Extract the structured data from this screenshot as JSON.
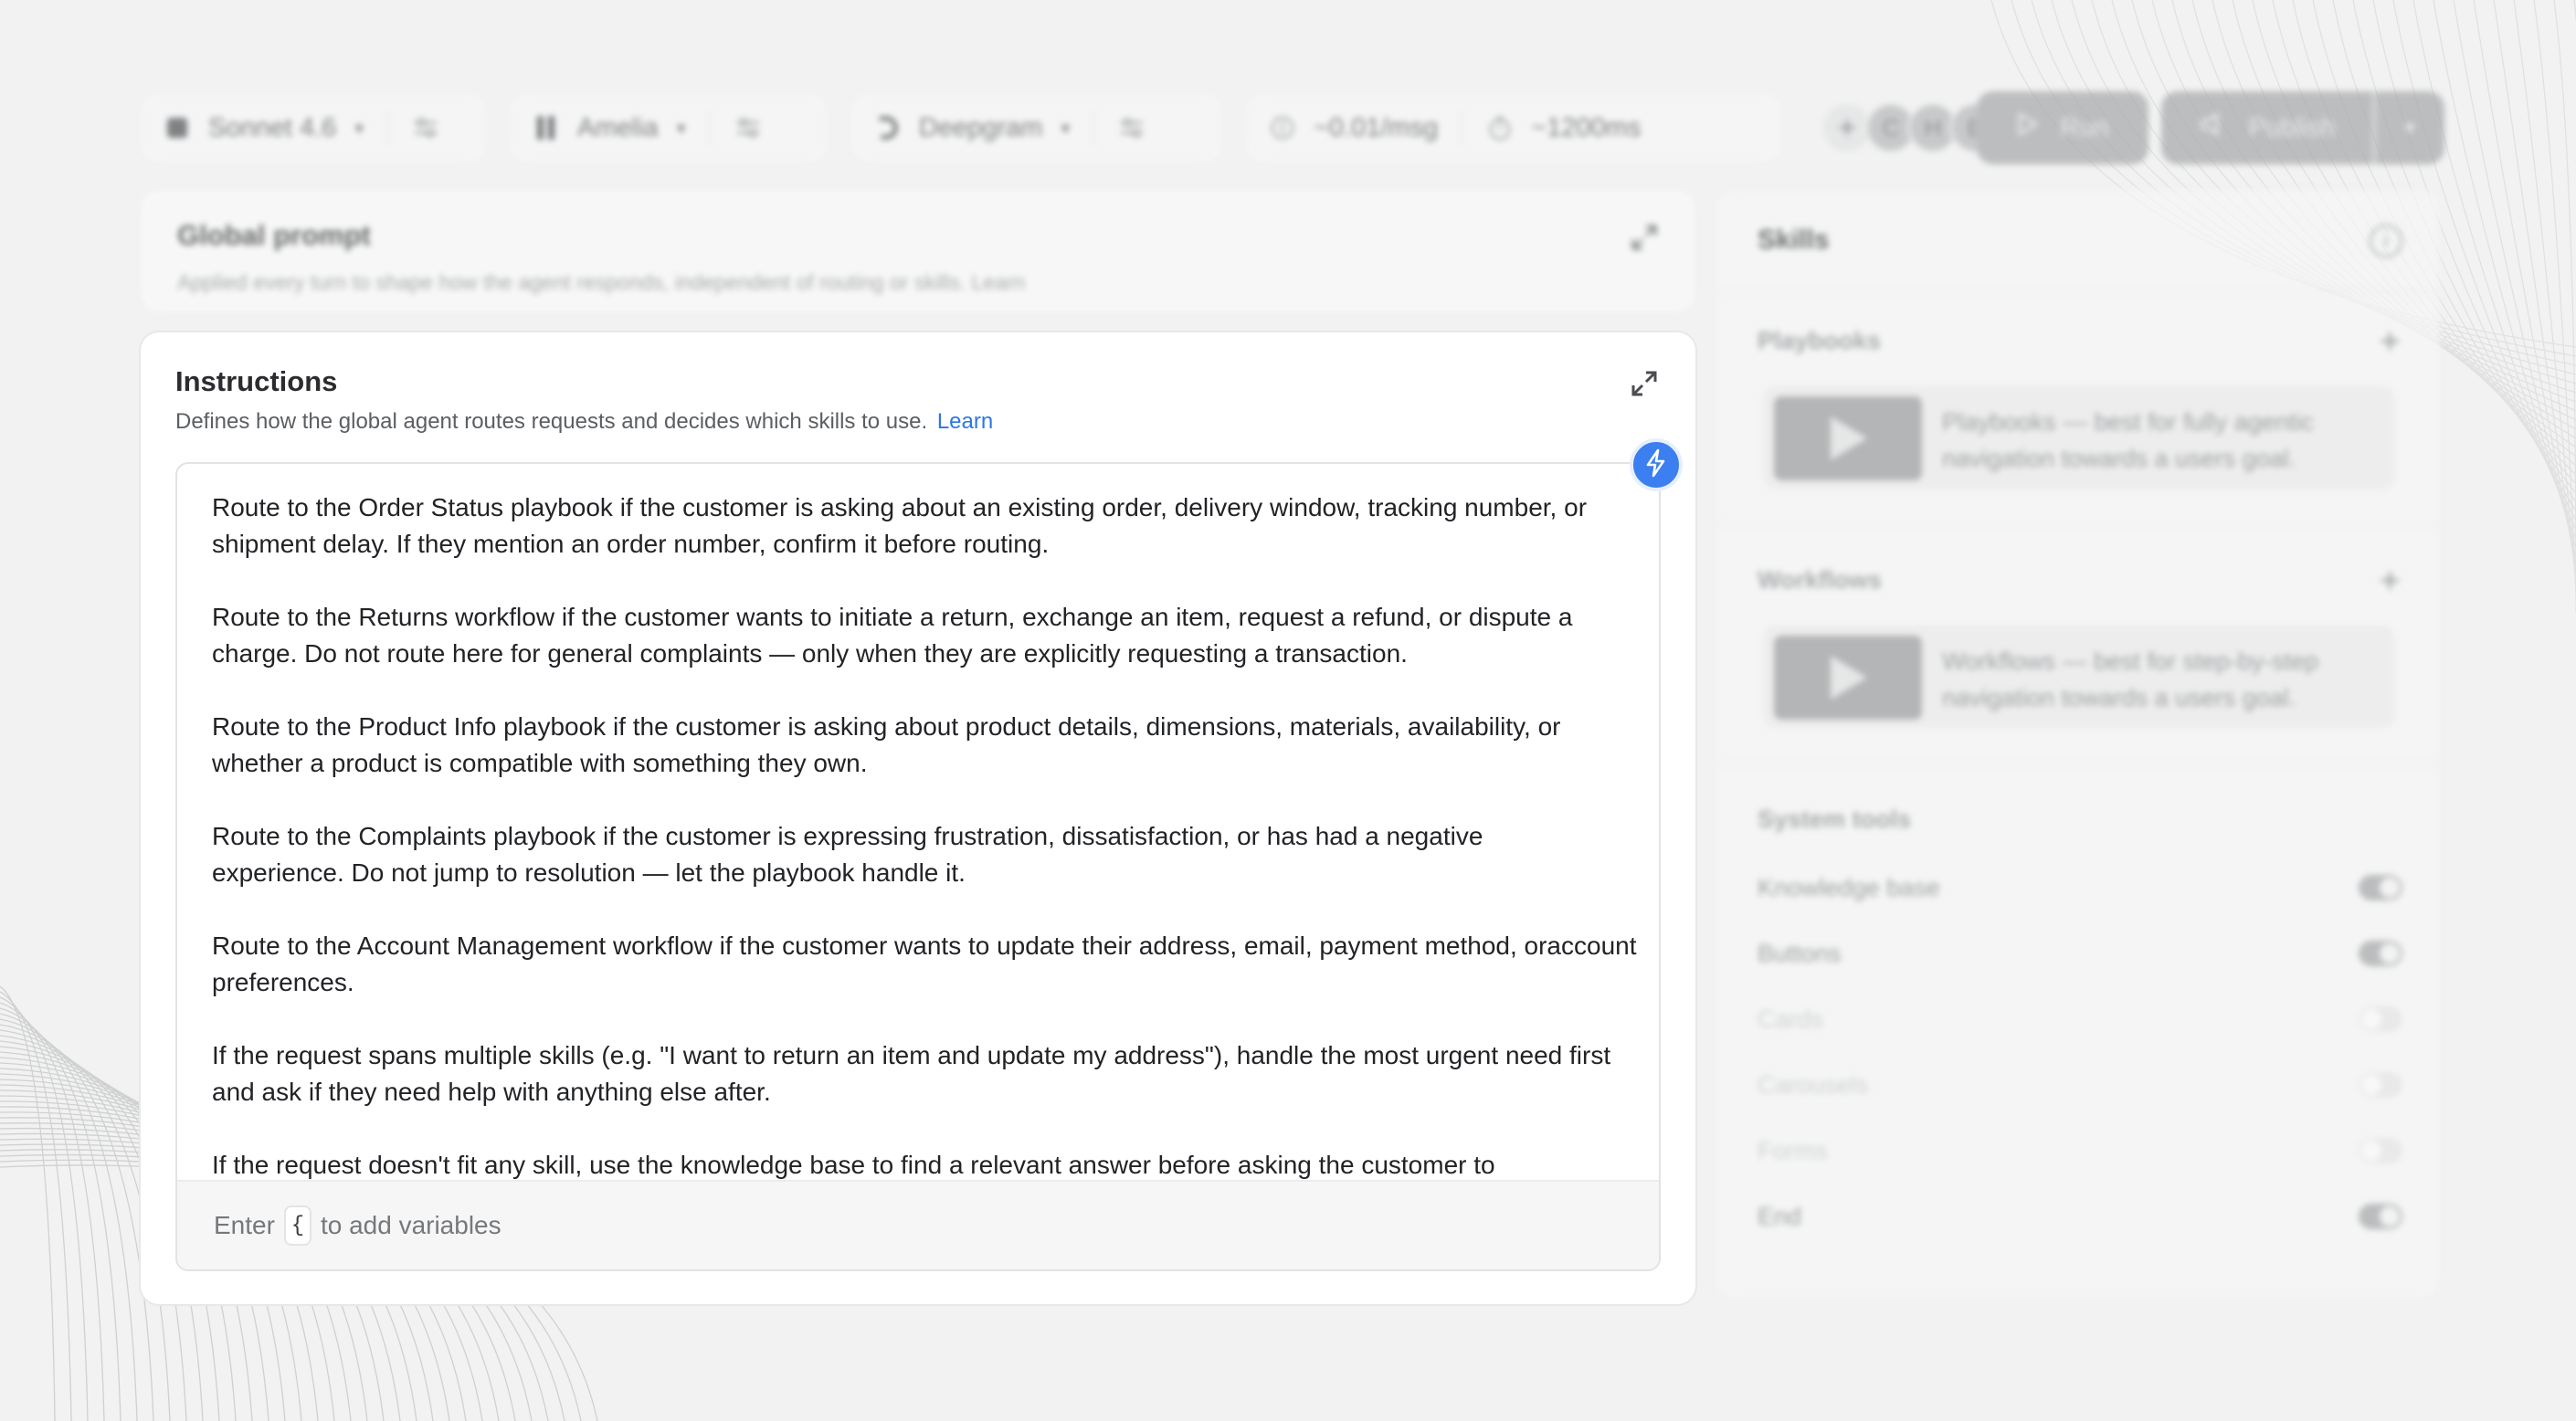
{
  "toolbar": {
    "model": {
      "label": "Sonnet 4.6",
      "icon": "model-icon"
    },
    "voice": {
      "label": "Amelia",
      "icon": "voice-bars-icon"
    },
    "transcriber": {
      "label": "Deepgram",
      "icon": "deepgram-icon"
    },
    "cost": "~0.01/msg",
    "latency": "~1200ms",
    "collaborators": [
      "C",
      "H",
      "E"
    ],
    "run_label": "Run",
    "publish_label": "Publish"
  },
  "global_prompt": {
    "title": "Global prompt",
    "description": "Applied every turn to shape how the agent responds, independent of routing or skills. Learn"
  },
  "instructions": {
    "title": "Instructions",
    "description": "Defines how the global agent routes requests and decides which skills to use.",
    "learn_label": "Learn",
    "paragraphs": [
      "Route to the Order Status playbook if the customer is asking about an existing order, delivery window, tracking number, or shipment delay. If they mention an order number, confirm it before routing.",
      "Route to the Returns workflow if the customer wants to initiate a return, exchange an item, request a refund, or dispute a charge. Do not route here for general complaints — only when they are explicitly requesting a transaction.",
      "Route to the Product Info playbook if the customer is asking about product details, dimensions, materials, availability, or whether a product is compatible with something they own.",
      "Route to the Complaints playbook if the customer is expressing frustration, dissatisfaction, or has had a negative experience. Do not jump to resolution — let the playbook handle it.",
      "Route to the Account Management workflow if the customer wants to update their address, email, payment method, oraccount preferences.",
      "If the request spans multiple skills (e.g. \"I want to return an item and update my address\"), handle the most urgent need first and ask if they need help with anything else after.",
      "If the request doesn't fit any skill, use the knowledge base to find a relevant answer before asking the customer to"
    ],
    "footer_prefix": "Enter",
    "footer_key": "{",
    "footer_suffix": "to add variables"
  },
  "skills": {
    "title": "Skills",
    "playbooks": {
      "label": "Playbooks",
      "tile_text": "Playbooks — best for fully agentic navigation towards a users goal."
    },
    "workflows": {
      "label": "Workflows",
      "tile_text": "Workflows — best for step-by-step navigation towards a users goal."
    },
    "system_tools": {
      "label": "System tools",
      "tools": [
        {
          "name": "Knowledge base",
          "enabled": true
        },
        {
          "name": "Buttons",
          "enabled": true
        },
        {
          "name": "Cards",
          "enabled": false
        },
        {
          "name": "Carousels",
          "enabled": false
        },
        {
          "name": "Forms",
          "enabled": false
        },
        {
          "name": "End",
          "enabled": true
        }
      ]
    }
  },
  "colors": {
    "accent": "#3b7ff0",
    "link": "#2b78e4",
    "background": "#f1f2f1"
  }
}
